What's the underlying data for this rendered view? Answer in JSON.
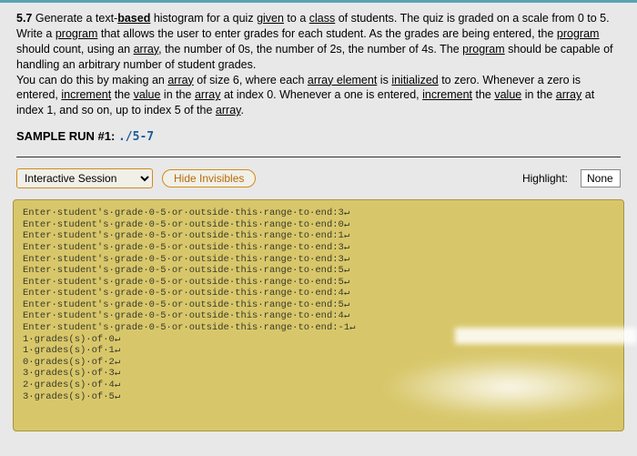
{
  "problem": {
    "number": "5.7",
    "text_parts": {
      "p1a": "Generate a text-",
      "p1b": "based",
      "p1c": " histogram for a quiz ",
      "p1d": "given",
      "p1e": " to a ",
      "p1f": "class",
      "p1g": " of students. The quiz is graded on a scale from 0 to 5. Write a ",
      "p1h": "program",
      "p1i": " that allows the user to enter grades for each student. As the grades are being entered, the ",
      "p1j": "program",
      "p1k": " should count, using an ",
      "p1l": "array",
      "p1m": ", the number of 0s, the number of 2s, the number of 4s. The ",
      "p1n": "program",
      "p1o": " should be capable of handling an arbitrary number of student grades.",
      "p2a": "You can do this by making an ",
      "p2b": "array",
      "p2c": " of size 6, where each ",
      "p2d": "array element",
      "p2e": " is ",
      "p2f": "initialized",
      "p2g": " to zero. Whenever a zero is entered, ",
      "p2h": "increment",
      "p2i": " the ",
      "p2j": "value",
      "p2k": " in the ",
      "p2l": "array",
      "p2m": " at index 0. Whenever a one is entered, ",
      "p2n": "increment",
      "p2o": " the ",
      "p2p": "value",
      "p2q": " in the ",
      "p2r": "array",
      "p2s": " at index 1, and so on, up to index 5 of the ",
      "p2t": "array",
      "p2u": "."
    }
  },
  "sample_run": {
    "label": "SAMPLE RUN #1:",
    "path": "./5-7"
  },
  "session_bar": {
    "select_label": "Interactive Session",
    "hide_btn": "Hide Invisibles",
    "highlight_label": "Highlight:",
    "highlight_value": "None"
  },
  "console_lines": [
    "Enter·student's·grade·0-5·or·outside·this·range·to·end:3↵",
    "Enter·student's·grade·0-5·or·outside·this·range·to·end:0↵",
    "Enter·student's·grade·0-5·or·outside·this·range·to·end:1↵",
    "Enter·student's·grade·0-5·or·outside·this·range·to·end:3↵",
    "Enter·student's·grade·0-5·or·outside·this·range·to·end:3↵",
    "Enter·student's·grade·0-5·or·outside·this·range·to·end:5↵",
    "Enter·student's·grade·0-5·or·outside·this·range·to·end:5↵",
    "Enter·student's·grade·0-5·or·outside·this·range·to·end:4↵",
    "Enter·student's·grade·0-5·or·outside·this·range·to·end:5↵",
    "Enter·student's·grade·0-5·or·outside·this·range·to·end:4↵",
    "Enter·student's·grade·0-5·or·outside·this·range·to·end:-1↵",
    "1·grades(s)·of·0↵",
    "1·grades(s)·of·1↵",
    "0·grades(s)·of·2↵",
    "3·grades(s)·of·3↵",
    "2·grades(s)·of·4↵",
    "3·grades(s)·of·5↵"
  ]
}
